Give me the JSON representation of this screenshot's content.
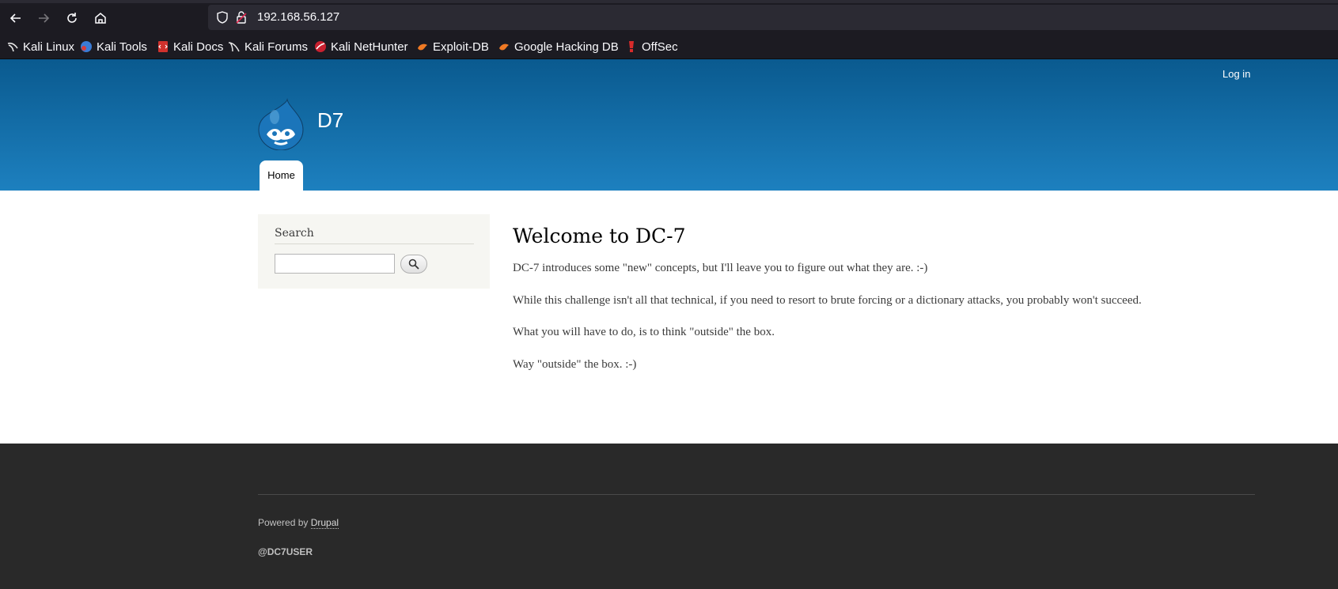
{
  "browser": {
    "url": "192.168.56.127",
    "bookmarks": [
      {
        "label": "Kali Linux",
        "icon": "kali-dragon-icon"
      },
      {
        "label": "Kali Tools",
        "icon": "kali-tools-icon"
      },
      {
        "label": "Kali Docs",
        "icon": "kali-docs-icon"
      },
      {
        "label": "Kali Forums",
        "icon": "kali-forums-icon"
      },
      {
        "label": "Kali NetHunter",
        "icon": "nethunter-icon"
      },
      {
        "label": "Exploit-DB",
        "icon": "exploit-db-icon"
      },
      {
        "label": "Google Hacking DB",
        "icon": "ghdb-icon"
      },
      {
        "label": "OffSec",
        "icon": "offsec-icon"
      }
    ]
  },
  "header": {
    "login_label": "Log in",
    "site_name": "D7",
    "logo_icon": "drupal-drop-logo",
    "tabs": [
      {
        "label": "Home"
      }
    ]
  },
  "sidebar": {
    "search_title": "Search",
    "search_value": "",
    "search_button_icon": "magnifier-icon"
  },
  "main": {
    "title": "Welcome to DC-7",
    "paragraphs": [
      "DC-7 introduces some \"new\" concepts, but I'll leave you to figure out what they are.  :-)",
      "While this challenge isn't all that technical, if you need to resort to brute forcing or a dictionary attacks, you probably won't succeed.",
      "What you will have to do, is to think \"outside\" the box.",
      "Way \"outside\" the box.  :-)"
    ]
  },
  "footer": {
    "powered_prefix": "Powered by",
    "powered_link": "Drupal",
    "handle": "@DC7USER"
  },
  "colors": {
    "header_top": "#0a5a8f",
    "header_bottom": "#1d80bf",
    "footer_bg": "#292929",
    "chrome_bg": "#1c1b22"
  }
}
